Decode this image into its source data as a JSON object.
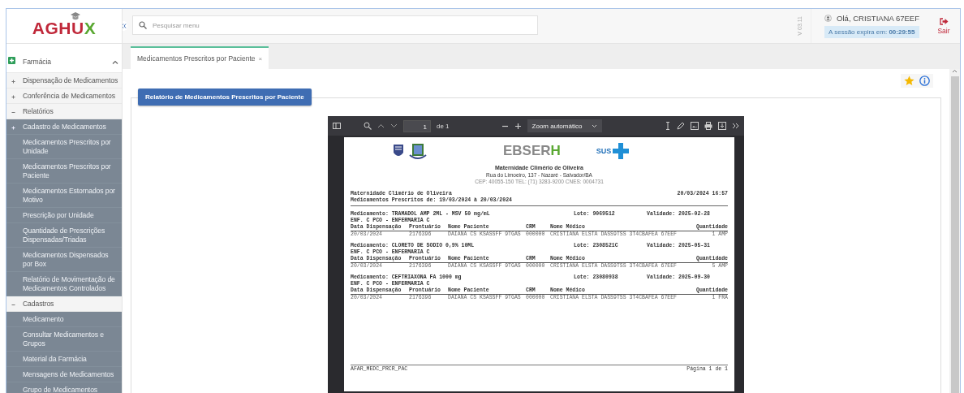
{
  "header": {
    "logo": {
      "main": "AGHU",
      "accent": "X"
    },
    "search": {
      "placeholder": "Pesquisar menu"
    },
    "version": "V 03.11",
    "user": {
      "greeting": "Olá, CRISTIANA 67EEF",
      "session_label": "A sessão expira em:",
      "session_time": "00:29:55"
    },
    "logout": "Sair"
  },
  "sidebar": {
    "items": [
      {
        "label": "Farmácia",
        "expanded": true,
        "children": [
          {
            "label": "Dispensação de Medicamentos",
            "expanded": false
          },
          {
            "label": "Conferência de Medicamentos",
            "expanded": false
          },
          {
            "label": "Relatórios",
            "expanded": true,
            "children": [
              {
                "label": "Cadastro de Medicamentos",
                "expanded": false
              },
              {
                "label": "Medicamentos Prescritos por Unidade"
              },
              {
                "label": "Medicamentos Prescritos por Paciente"
              },
              {
                "label": "Medicamentos Estornados por Motivo"
              },
              {
                "label": "Prescrição por Unidade"
              },
              {
                "label": "Quantidade de Prescrições Dispensadas/Triadas"
              },
              {
                "label": "Medicamentos Dispensados por Box"
              },
              {
                "label": "Relatório de Movimentação de Medicamentos Controlados"
              }
            ]
          },
          {
            "label": "Cadastros",
            "expanded": true,
            "children": [
              {
                "label": "Medicamento"
              },
              {
                "label": "Consultar Medicamentos e Grupos"
              },
              {
                "label": "Material da Farmácia"
              },
              {
                "label": "Mensagens de Medicamentos"
              },
              {
                "label": "Grupo de Medicamentos"
              }
            ]
          }
        ]
      }
    ]
  },
  "tabs": [
    {
      "label": "Medicamentos Prescritos por Paciente",
      "close": "×",
      "selected": true
    }
  ],
  "report_button": "Relatório de Medicamentos Prescritos por Paciente",
  "pdf_viewer": {
    "page": "1",
    "page_count": "de 1",
    "zoom": "Zoom automático",
    "document": {
      "brand": "EBSERH",
      "sus": "SUS",
      "institution": "Maternidade Climério de Oliveira",
      "address": "Rua do Limoeiro, 137 - Nazaré - Salvador/BA",
      "contact": "CEP: 40055-150   TEL: (71) 3283-9200   CNES: 0004731",
      "report_org": "Maternidade Climério de Oliveira",
      "report_title": "Medicamentos Prescritos de: 19/03/2024 à 20/03/2024",
      "printed_at": "20/03/2024 16:57",
      "sections": [
        {
          "drug": "Medicamento: TRAMADOL AMP 2ML - MSV 50 mg/mL",
          "lot": "Lote: 9069512",
          "validity": "Validade: 2025-02-28",
          "unit": "ENF. C PCO - ENFERMARIA C",
          "columns": [
            "Data Dispensação",
            "Prontuário",
            "Nome Paciente",
            "CRM",
            "Nome Médico",
            "Quantidade"
          ],
          "row": [
            "20/03/2024",
            "2176396",
            "DAIANA CS KSASSFF 9TGAS",
            "000000",
            "CRISTIANA ELSTA DASS9TSS 3T4CBAFEA 67EEF",
            "1 AMP"
          ]
        },
        {
          "drug": "Medicamento: CLORETO DE SODIO 0,9% 10ML",
          "lot": "Lote: 2308521C",
          "validity": "Validade: 2025-05-31",
          "unit": "ENF. C PCO - ENFERMARIA C",
          "columns": [
            "Data Dispensação",
            "Prontuário",
            "Nome Paciente",
            "CRM",
            "Nome Médico",
            "Quantidade"
          ],
          "row": [
            "20/03/2024",
            "2176396",
            "DAIANA CS KSASSFF 9TGAS",
            "000000",
            "CRISTIANA ELSTA DASS9TSS 3T4CBAFEA 67EEF",
            "5 AMP"
          ]
        },
        {
          "drug": "Medicamento: CEFTRIAXONA FA 1000 mg",
          "lot": "Lote: 23080938",
          "validity": "Validade: 2025-09-30",
          "unit": "ENF. C PCO - ENFERMARIA C",
          "columns": [
            "Data Dispensação",
            "Prontuário",
            "Nome Paciente",
            "CRM",
            "Nome Médico",
            "Quantidade"
          ],
          "row": [
            "20/03/2024",
            "2176396",
            "DAIANA CS KSASSFF 9TGAS",
            "000000",
            "CRISTIANA ELSTA DASS9TSS 3T4CBAFEA 67EEF",
            "1 FRA"
          ]
        }
      ],
      "footer_code": "AFAR_MEDC_PRCR_PAC",
      "footer_page": "Página 1 de 1"
    }
  }
}
